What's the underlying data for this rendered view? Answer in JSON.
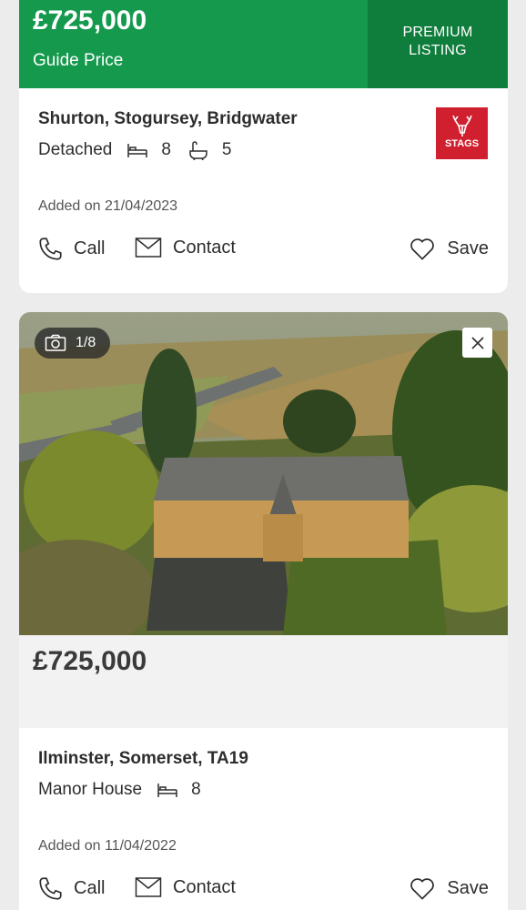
{
  "listing1": {
    "price": "£725,000",
    "price_qualifier": "Guide Price",
    "badge": "PREMIUM\nLISTING",
    "address": "Shurton, Stogursey, Bridgwater",
    "property_type": "Detached",
    "bedrooms": "8",
    "bathrooms": "5",
    "added": "Added on 21/04/2023",
    "agent_logo_text": "STAGS",
    "actions": {
      "call": "Call",
      "contact": "Contact",
      "save": "Save"
    }
  },
  "listing2": {
    "photo_counter": "1/8",
    "price": "£725,000",
    "address": "Ilminster, Somerset, TA19",
    "property_type": "Manor House",
    "bedrooms": "8",
    "added": "Added on 11/04/2022",
    "actions": {
      "call": "Call",
      "contact": "Contact",
      "save": "Save"
    }
  },
  "colors": {
    "banner_green": "#15994d",
    "premium_green": "#0f7d3c",
    "agent_red": "#d0202f",
    "background": "#ececec"
  }
}
